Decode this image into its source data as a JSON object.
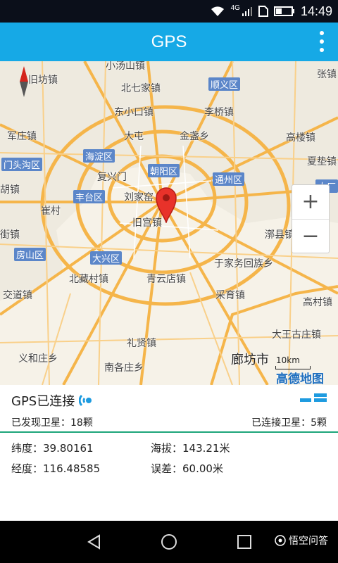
{
  "status": {
    "network": "4G",
    "time": "14:49"
  },
  "appbar": {
    "title": "GPS",
    "menu_icon": "more-vert-icon"
  },
  "map": {
    "places": [
      "小汤山镇",
      "旧坊镇",
      "北七家镇",
      "顺义区",
      "张镇",
      "东小口镇",
      "李桥镇",
      "军庄镇",
      "大屯",
      "金盏乡",
      "高楼镇",
      "海淀区",
      "门头沟区",
      "夏垫镇",
      "复兴门",
      "朝阳区",
      "通州区",
      "大厂",
      "丰台区",
      "刘家窑",
      "崔村",
      "旧宫镇",
      "漷县镇",
      "房山区",
      "大兴区",
      "于家务回族乡",
      "北藏村镇",
      "青云店镇",
      "交道镇",
      "采育镇",
      "高村镇",
      "大王古庄镇",
      "礼贤镇",
      "义和庄乡",
      "南各庄乡",
      "廊坊市",
      "街镇",
      "胡镇"
    ],
    "scale": "10km",
    "provider": "高德地图",
    "zoom_in": "+",
    "zoom_out": "−"
  },
  "panel": {
    "status_title": "GPS已连接",
    "satellites_found": "已发现卫星：18颗",
    "satellites_connected": "已连接卫星：5颗",
    "latitude": "纬度：39.80161",
    "altitude": "海拔：143.21米",
    "longitude": "经度：116.48585",
    "error": "误差：60.00米"
  },
  "watermark": "悟空问答",
  "colors": {
    "appbar": "#16a9e6",
    "divider": "#1da57a"
  }
}
